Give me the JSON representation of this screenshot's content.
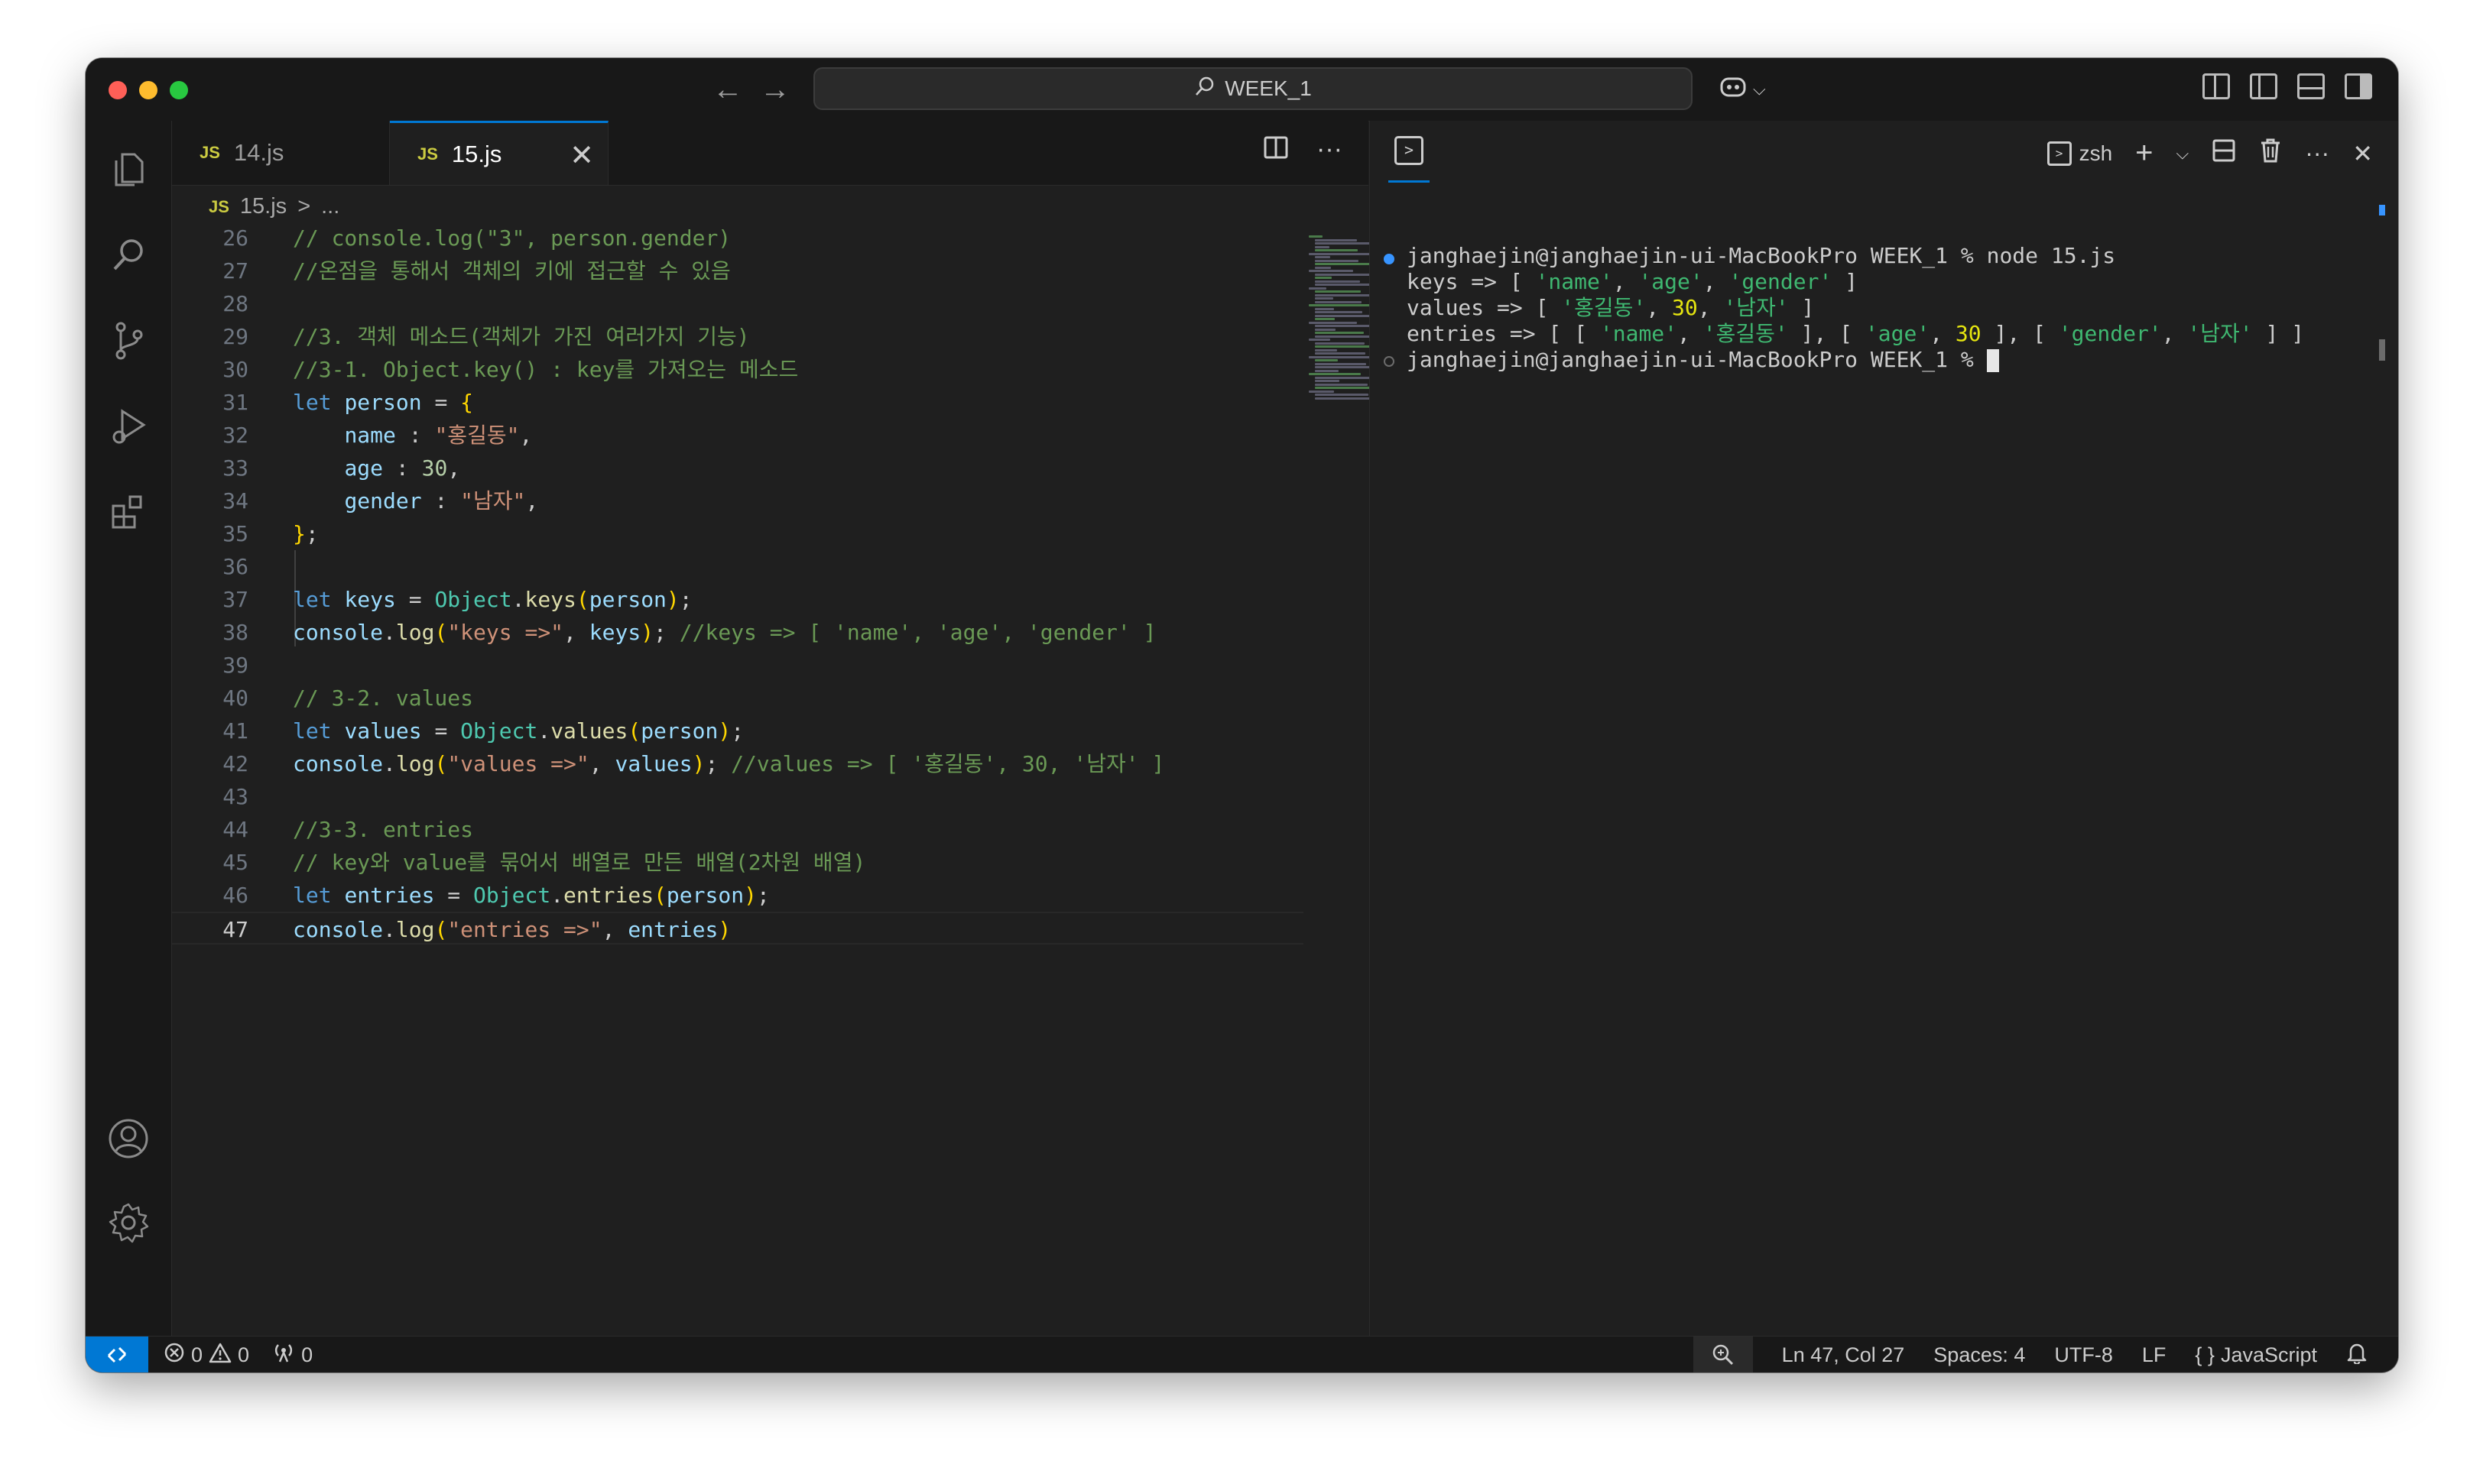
{
  "titlebar": {
    "search_text": "WEEK_1",
    "back_icon": "←",
    "forward_icon": "→",
    "copilot_icon": "copilot-icon",
    "chevron": "⌵"
  },
  "activity_bar": {
    "icons": [
      "files-icon",
      "search-icon",
      "source-control-icon",
      "run-debug-icon",
      "extensions-icon",
      "account-icon",
      "settings-gear-icon"
    ]
  },
  "editor": {
    "tabs": [
      {
        "badge": "JS",
        "label": "14.js"
      },
      {
        "badge": "JS",
        "label": "15.js"
      }
    ],
    "close_glyph": "✕",
    "more_glyph": "···",
    "breadcrumb": {
      "badge": "JS",
      "file": "15.js",
      "sep": ">",
      "rest": "..."
    },
    "lines": [
      {
        "n": "26",
        "tokens": [
          {
            "t": "// console.log(\"3\", person.gender)",
            "c": "c-com"
          }
        ]
      },
      {
        "n": "27",
        "tokens": [
          {
            "t": "//온점을 통해서 객체의 키에 접근할 수 있음",
            "c": "c-com"
          }
        ]
      },
      {
        "n": "28",
        "tokens": []
      },
      {
        "n": "29",
        "tokens": [
          {
            "t": "//3. 객체 메소드(객체가 가진 여러가지 기능)",
            "c": "c-com"
          }
        ]
      },
      {
        "n": "30",
        "tokens": [
          {
            "t": "//3-1. Object.key() : key를 가져오는 메소드",
            "c": "c-com"
          }
        ]
      },
      {
        "n": "31",
        "tokens": [
          {
            "t": "let",
            "c": "c-kw"
          },
          {
            "t": " ",
            "c": "c-pun"
          },
          {
            "t": "person",
            "c": "c-var"
          },
          {
            "t": " = ",
            "c": "c-pun"
          },
          {
            "t": "{",
            "c": "c-br1"
          }
        ]
      },
      {
        "n": "32",
        "tokens": [
          {
            "t": "    ",
            "c": "c-pun"
          },
          {
            "t": "name",
            "c": "c-var"
          },
          {
            "t": " : ",
            "c": "c-pun"
          },
          {
            "t": "\"홍길동\"",
            "c": "c-str"
          },
          {
            "t": ",",
            "c": "c-pun"
          }
        ]
      },
      {
        "n": "33",
        "tokens": [
          {
            "t": "    ",
            "c": "c-pun"
          },
          {
            "t": "age",
            "c": "c-var"
          },
          {
            "t": " : ",
            "c": "c-pun"
          },
          {
            "t": "30",
            "c": "c-num"
          },
          {
            "t": ",",
            "c": "c-pun"
          }
        ]
      },
      {
        "n": "34",
        "tokens": [
          {
            "t": "    ",
            "c": "c-pun"
          },
          {
            "t": "gender",
            "c": "c-var"
          },
          {
            "t": " : ",
            "c": "c-pun"
          },
          {
            "t": "\"남자\"",
            "c": "c-str"
          },
          {
            "t": ",",
            "c": "c-pun"
          }
        ]
      },
      {
        "n": "35",
        "tokens": [
          {
            "t": "}",
            "c": "c-br1"
          },
          {
            "t": ";",
            "c": "c-pun"
          }
        ]
      },
      {
        "n": "36",
        "tokens": []
      },
      {
        "n": "37",
        "tokens": [
          {
            "t": "let",
            "c": "c-kw"
          },
          {
            "t": " ",
            "c": "c-pun"
          },
          {
            "t": "keys",
            "c": "c-var"
          },
          {
            "t": " = ",
            "c": "c-pun"
          },
          {
            "t": "Object",
            "c": "c-cls"
          },
          {
            "t": ".",
            "c": "c-pun"
          },
          {
            "t": "keys",
            "c": "c-fn"
          },
          {
            "t": "(",
            "c": "c-br1"
          },
          {
            "t": "person",
            "c": "c-var"
          },
          {
            "t": ")",
            "c": "c-br1"
          },
          {
            "t": ";",
            "c": "c-pun"
          }
        ]
      },
      {
        "n": "38",
        "tokens": [
          {
            "t": "console",
            "c": "c-var"
          },
          {
            "t": ".",
            "c": "c-pun"
          },
          {
            "t": "log",
            "c": "c-fn"
          },
          {
            "t": "(",
            "c": "c-br1"
          },
          {
            "t": "\"keys =>\"",
            "c": "c-str"
          },
          {
            "t": ", ",
            "c": "c-pun"
          },
          {
            "t": "keys",
            "c": "c-var"
          },
          {
            "t": ")",
            "c": "c-br1"
          },
          {
            "t": "; ",
            "c": "c-pun"
          },
          {
            "t": "//keys => [ 'name', 'age', 'gender' ]",
            "c": "c-com"
          }
        ]
      },
      {
        "n": "39",
        "tokens": []
      },
      {
        "n": "40",
        "tokens": [
          {
            "t": "// 3-2. values",
            "c": "c-com"
          }
        ]
      },
      {
        "n": "41",
        "tokens": [
          {
            "t": "let",
            "c": "c-kw"
          },
          {
            "t": " ",
            "c": "c-pun"
          },
          {
            "t": "values",
            "c": "c-var"
          },
          {
            "t": " = ",
            "c": "c-pun"
          },
          {
            "t": "Object",
            "c": "c-cls"
          },
          {
            "t": ".",
            "c": "c-pun"
          },
          {
            "t": "values",
            "c": "c-fn"
          },
          {
            "t": "(",
            "c": "c-br1"
          },
          {
            "t": "person",
            "c": "c-var"
          },
          {
            "t": ")",
            "c": "c-br1"
          },
          {
            "t": ";",
            "c": "c-pun"
          }
        ]
      },
      {
        "n": "42",
        "tokens": [
          {
            "t": "console",
            "c": "c-var"
          },
          {
            "t": ".",
            "c": "c-pun"
          },
          {
            "t": "log",
            "c": "c-fn"
          },
          {
            "t": "(",
            "c": "c-br1"
          },
          {
            "t": "\"values =>\"",
            "c": "c-str"
          },
          {
            "t": ", ",
            "c": "c-pun"
          },
          {
            "t": "values",
            "c": "c-var"
          },
          {
            "t": ")",
            "c": "c-br1"
          },
          {
            "t": "; ",
            "c": "c-pun"
          },
          {
            "t": "//values => [ '홍길동', 30, '남자' ]",
            "c": "c-com"
          }
        ]
      },
      {
        "n": "43",
        "tokens": []
      },
      {
        "n": "44",
        "tokens": [
          {
            "t": "//3-3. entries",
            "c": "c-com"
          }
        ]
      },
      {
        "n": "45",
        "tokens": [
          {
            "t": "// key와 value를 묶어서 배열로 만든 배열(2차원 배열)",
            "c": "c-com"
          }
        ]
      },
      {
        "n": "46",
        "tokens": [
          {
            "t": "let",
            "c": "c-kw"
          },
          {
            "t": " ",
            "c": "c-pun"
          },
          {
            "t": "entries",
            "c": "c-var"
          },
          {
            "t": " = ",
            "c": "c-pun"
          },
          {
            "t": "Object",
            "c": "c-cls"
          },
          {
            "t": ".",
            "c": "c-pun"
          },
          {
            "t": "entries",
            "c": "c-fn"
          },
          {
            "t": "(",
            "c": "c-br1"
          },
          {
            "t": "person",
            "c": "c-var"
          },
          {
            "t": ")",
            "c": "c-br1"
          },
          {
            "t": ";",
            "c": "c-pun"
          }
        ]
      },
      {
        "n": "47",
        "tokens": [
          {
            "t": "console",
            "c": "c-var"
          },
          {
            "t": ".",
            "c": "c-pun"
          },
          {
            "t": "log",
            "c": "c-fn"
          },
          {
            "t": "(",
            "c": "c-br1"
          },
          {
            "t": "\"entries =>\"",
            "c": "c-str"
          },
          {
            "t": ", ",
            "c": "c-pun"
          },
          {
            "t": "entries",
            "c": "c-var"
          },
          {
            "t": ")",
            "c": "c-br1"
          }
        ]
      }
    ]
  },
  "terminal": {
    "shell_label": "zsh",
    "plus": "+",
    "chevron": "⌵",
    "more": "···",
    "close": "✕",
    "lines": [
      [
        {
          "t": "janghaejin@janghaejin-ui-MacBookPro WEEK_1 % node 15.js",
          "c": ""
        }
      ],
      [
        {
          "t": "keys => [ ",
          "c": ""
        },
        {
          "t": "'name'",
          "c": "t-str"
        },
        {
          "t": ", ",
          "c": ""
        },
        {
          "t": "'age'",
          "c": "t-str"
        },
        {
          "t": ", ",
          "c": ""
        },
        {
          "t": "'gender'",
          "c": "t-str"
        },
        {
          "t": " ]",
          "c": ""
        }
      ],
      [
        {
          "t": "values => [ ",
          "c": ""
        },
        {
          "t": "'홍길동'",
          "c": "t-str"
        },
        {
          "t": ", ",
          "c": ""
        },
        {
          "t": "30",
          "c": "t-num"
        },
        {
          "t": ", ",
          "c": ""
        },
        {
          "t": "'남자'",
          "c": "t-str"
        },
        {
          "t": " ]",
          "c": ""
        }
      ],
      [
        {
          "t": "entries => [ [ ",
          "c": ""
        },
        {
          "t": "'name'",
          "c": "t-str"
        },
        {
          "t": ", ",
          "c": ""
        },
        {
          "t": "'홍길동'",
          "c": "t-str"
        },
        {
          "t": " ], [ ",
          "c": ""
        },
        {
          "t": "'age'",
          "c": "t-str"
        },
        {
          "t": ", ",
          "c": ""
        },
        {
          "t": "30",
          "c": "t-num"
        },
        {
          "t": " ], [ ",
          "c": ""
        },
        {
          "t": "'gender'",
          "c": "t-str"
        },
        {
          "t": ", ",
          "c": ""
        },
        {
          "t": "'남자'",
          "c": "t-str"
        },
        {
          "t": " ] ]",
          "c": ""
        }
      ],
      [
        {
          "t": "janghaejin@janghaejin-ui-MacBookPro WEEK_1 % ",
          "c": ""
        }
      ]
    ]
  },
  "statusbar": {
    "remote_icon": "remote-icon",
    "errors": "0",
    "warnings": "0",
    "ports": "0",
    "cursor_pos": "Ln 47, Col 27",
    "spaces": "Spaces: 4",
    "encoding": "UTF-8",
    "eol": "LF",
    "language": "JavaScript",
    "language_icon": "{ }"
  },
  "colors": {
    "accent": "#0078d4",
    "editor_bg": "#1f1f1f",
    "chrome_bg": "#181818"
  }
}
